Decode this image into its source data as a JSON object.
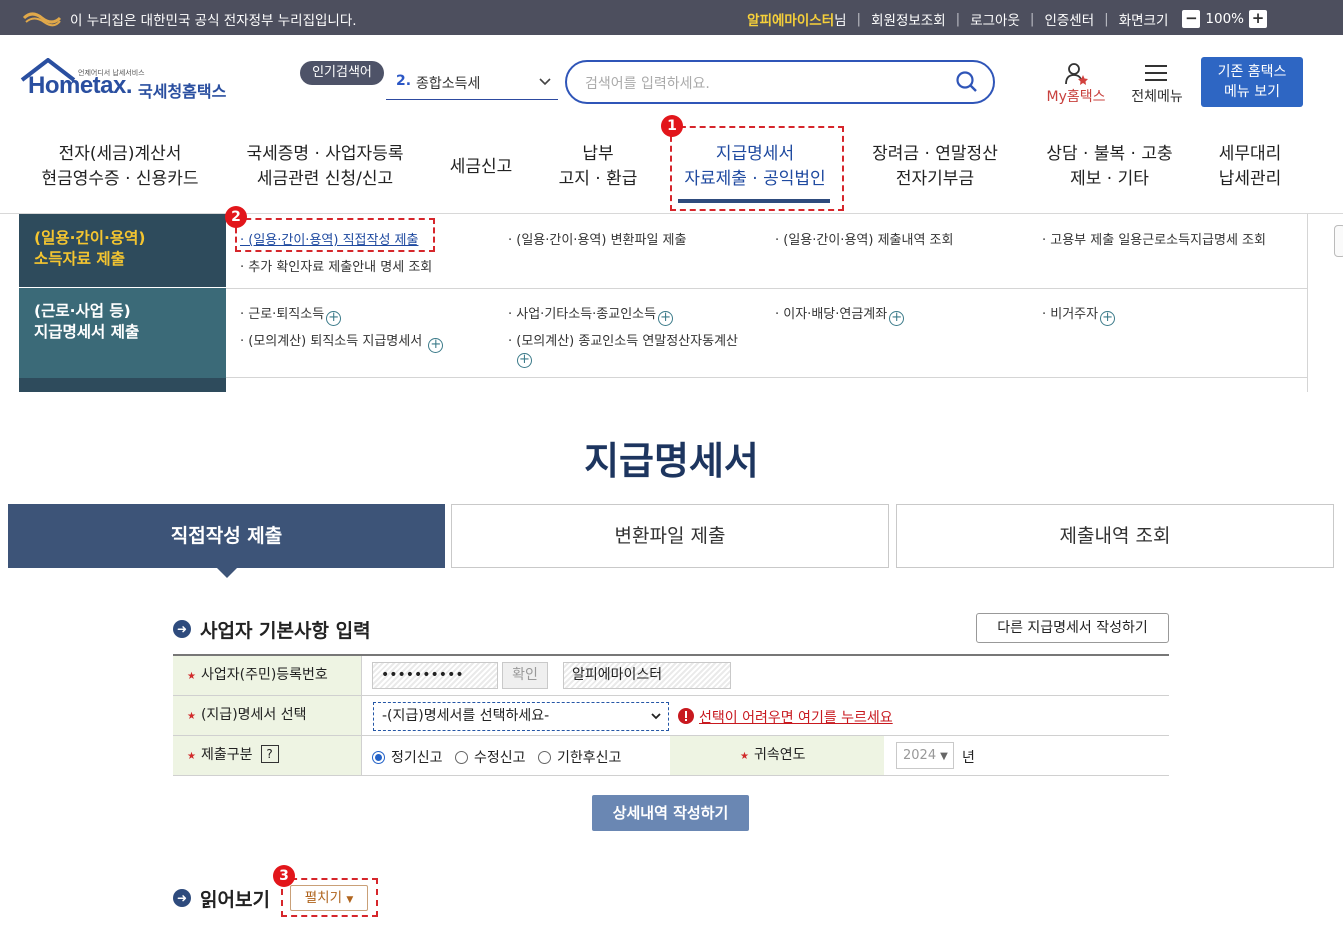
{
  "gov_bar": {
    "notice": "이 누리집은 대한민국 공식 전자정부 누리집입니다.",
    "user_name": "알피에마이스터",
    "user_suffix": "님",
    "links": [
      "회원정보조회",
      "로그아웃",
      "인증센터",
      "화면크기"
    ],
    "zoom": "100%",
    "zoom_minus": "−",
    "zoom_plus": "+"
  },
  "header": {
    "logo_main": "Hometax.",
    "logo_small": "언제어디서 납세서비스",
    "logo_kr": "국세청홈택스",
    "popular_label": "인기검색어",
    "popular_rank": "2.",
    "popular_term": "종합소득세",
    "search_placeholder": "검색어를 입력하세요.",
    "my_hometax": "My홈택스",
    "all_menu": "전체메뉴",
    "old_menu_line1": "기존 홈택스",
    "old_menu_line2": "메뉴 보기"
  },
  "gnb": [
    {
      "line1": "전자(세금)계산서",
      "line2": "현금영수증 · 신용카드"
    },
    {
      "line1": "국세증명 · 사업자등록",
      "line2": "세금관련 신청/신고"
    },
    {
      "line1": "세금신고",
      "line2": ""
    },
    {
      "line1": "납부",
      "line2": "고지 · 환급"
    },
    {
      "line1": "지급명세서",
      "line2": "자료제출 · 공익법인"
    },
    {
      "line1": "장려금 · 연말정산",
      "line2": "전자기부금"
    },
    {
      "line1": "상담 · 불복 · 고충",
      "line2": "제보 · 기타"
    },
    {
      "line1": "세무대리",
      "line2": "납세관리"
    }
  ],
  "submenu": {
    "group1": {
      "title1": "(일용·간이·용역)",
      "title2": "소득자료 제출",
      "items": [
        "· (일용·간이·용역) 직접작성 제출",
        "· (일용·간이·용역) 변환파일 제출",
        "· (일용·간이·용역) 제출내역 조회",
        "· 고용부 제출 일용근로소득지급명세 조회",
        "· 추가 확인자료 제출안내 명세 조회"
      ]
    },
    "group2": {
      "title1": "(근로·사업 등)",
      "title2": "지급명세서 제출",
      "items": [
        "· 근로·퇴직소득",
        "· 사업·기타소득·종교인소득",
        "· 이자·배당·연금계좌",
        "· 비거주자",
        "· (모의계산) 퇴직소득 지급명세서",
        "· (모의계산) 종교인소득 연말정산자동계산"
      ]
    }
  },
  "page": {
    "title": "지급명세서",
    "tabs": [
      "직접작성 제출",
      "변환파일 제출",
      "제출내역 조회"
    ]
  },
  "section1": {
    "title": "사업자 기본사항 입력",
    "other_button": "다른 지급명세서 작성하기",
    "rows": {
      "bizno_label": "사업자(주민)등록번호",
      "bizno_value": "••••••••••",
      "confirm_label": "확인",
      "biz_name": "알피에마이스터",
      "type_label": "(지급)명세서 선택",
      "type_value": "-(지급)명세서를 선택하세요-",
      "help_text": "선택이 어려우면 여기를 누르세요",
      "submit_label": "제출구분",
      "help_q": "?",
      "radio_options": [
        "정기신고",
        "수정신고",
        "기한후신고"
      ],
      "year_label": "귀속연도",
      "year_value": "2024",
      "year_unit": "년"
    },
    "detail_button": "상세내역 작성하기"
  },
  "section2": {
    "title": "읽어보기",
    "expand_button": "펼치기"
  },
  "badges": [
    "1",
    "2",
    "3"
  ],
  "colors": {
    "gov_bar": "#4d4f5e",
    "brand_blue": "#2e66c3",
    "active_tab": "#3d5478",
    "annotation_red": "#d6262b"
  }
}
